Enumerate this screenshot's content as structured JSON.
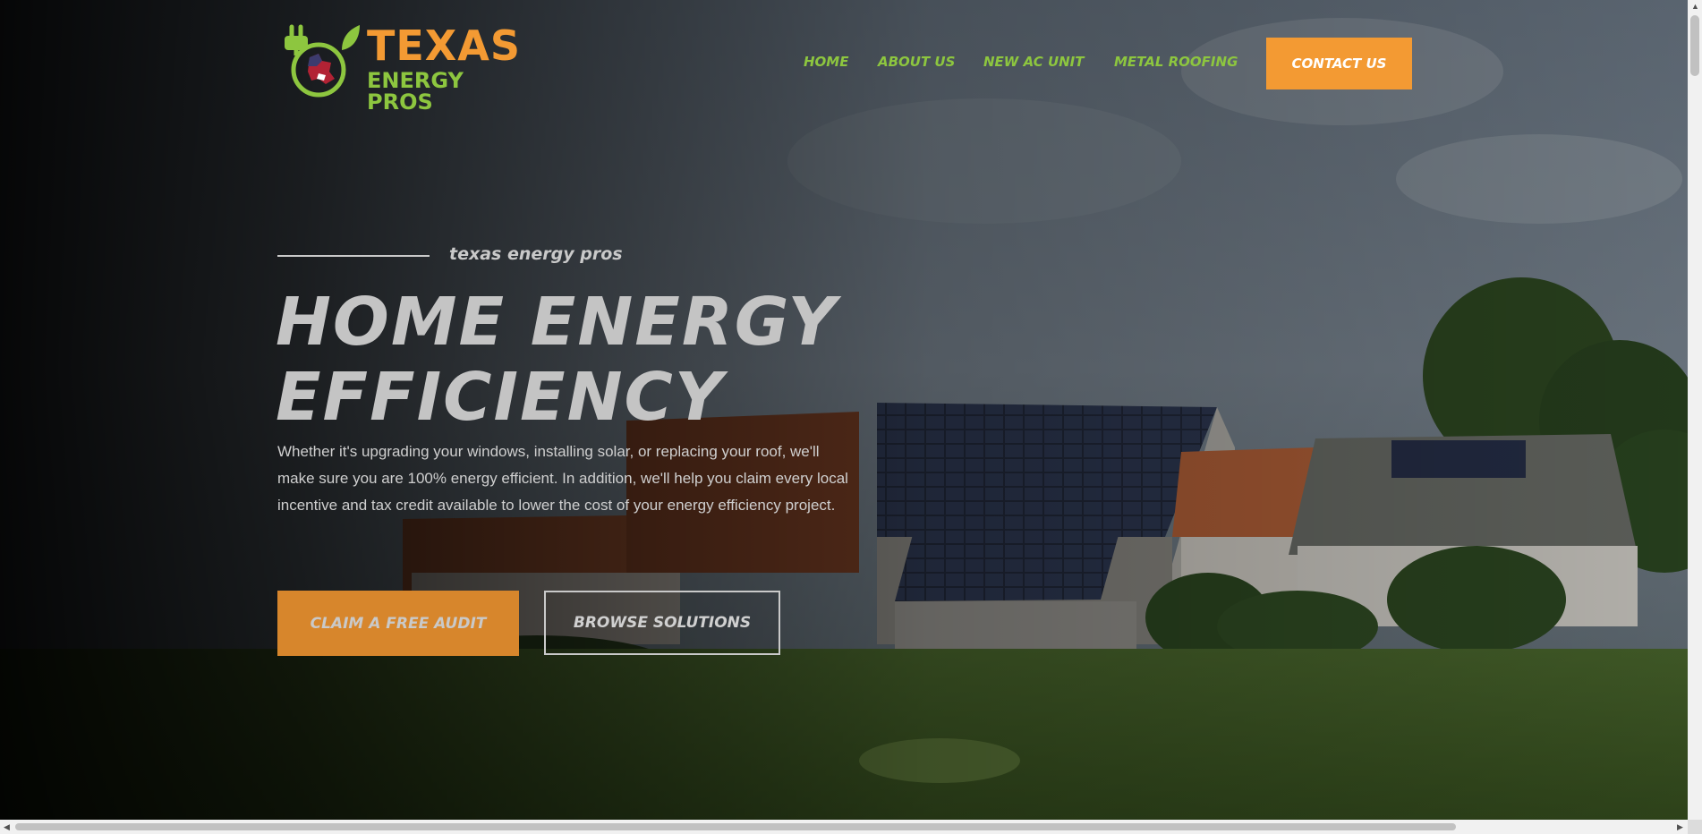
{
  "logo": {
    "line1": "TEXAS",
    "line2": "ENERGY PROS"
  },
  "nav": {
    "items": [
      {
        "label": "HOME"
      },
      {
        "label": "ABOUT US"
      },
      {
        "label": "NEW AC UNIT"
      },
      {
        "label": "METAL ROOFING"
      }
    ],
    "contact_label": "CONTACT US"
  },
  "hero": {
    "eyebrow": "texas energy pros",
    "title_line1": "HOME ENERGY",
    "title_line2": "EFFICIENCY",
    "description": "Whether it's upgrading your windows, installing solar, or replacing your roof, we'll make sure you are 100% energy efficient. In addition, we'll help you claim every local incentive and tax credit available to lower the cost of your energy efficiency project.",
    "primary_button": "CLAIM A FREE AUDIT",
    "secondary_button": "BROWSE SOLUTIONS"
  },
  "colors": {
    "accent_orange": "#f39a33",
    "accent_green": "#8dc63f",
    "text_light": "#c9c9c9"
  }
}
